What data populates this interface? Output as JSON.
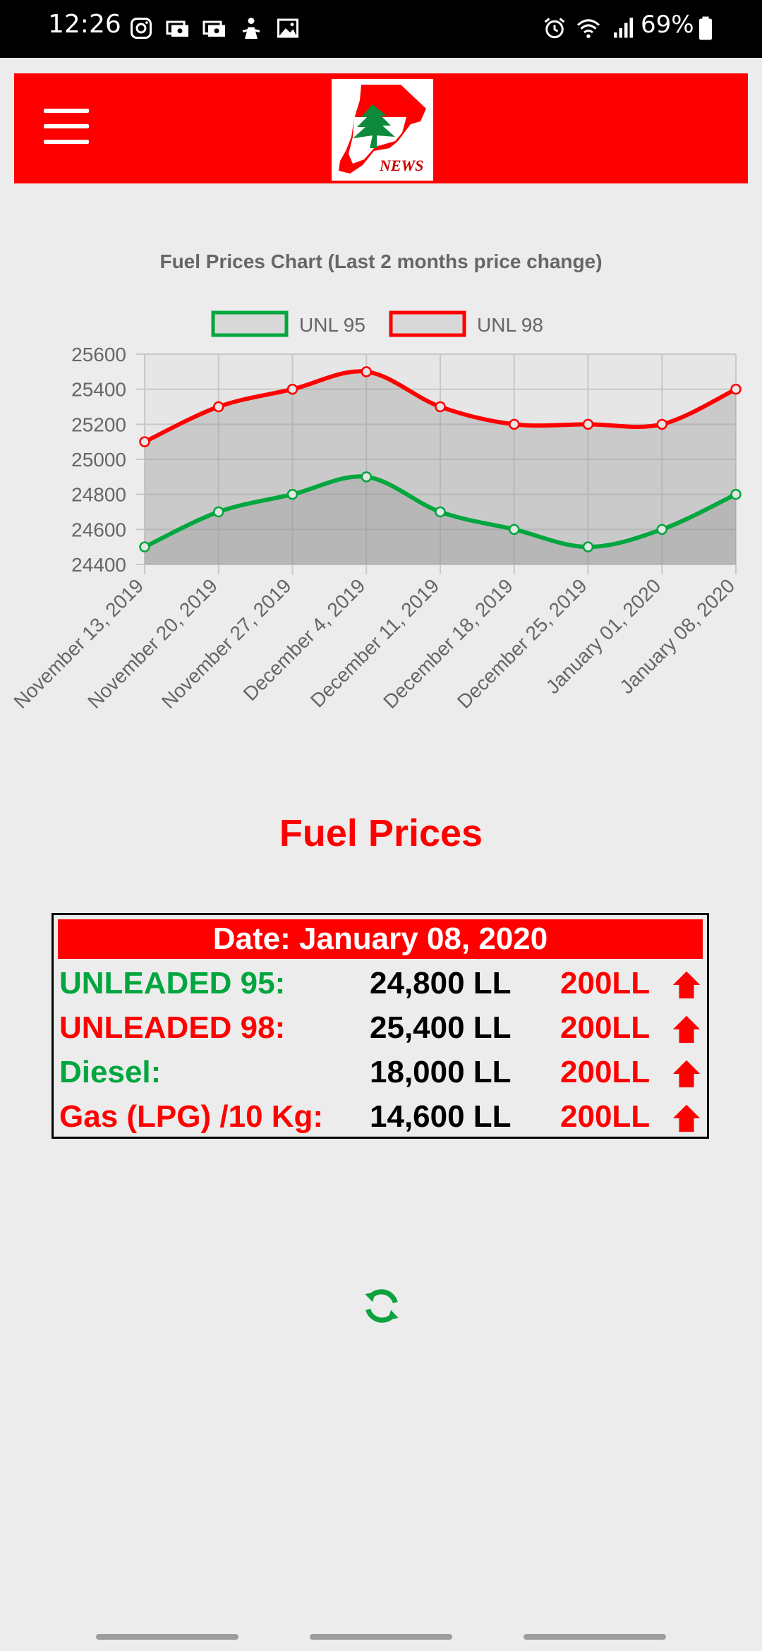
{
  "status_bar": {
    "time": "12:26",
    "battery_percent": "69%",
    "left_icons": [
      "instagram-icon",
      "money-icon",
      "money-icon",
      "person-icon",
      "image-icon"
    ],
    "right_icons": [
      "alarm-icon",
      "wifi-icon",
      "signal-icon",
      "battery-icon"
    ]
  },
  "header": {
    "logo_text": "NEWS",
    "background": "#ff0000",
    "menu_icon": "hamburger-icon"
  },
  "chart_data": {
    "type": "line",
    "title": "Fuel Prices Chart (Last 2 months price change)",
    "categories": [
      "November 13, 2019",
      "November 20, 2019",
      "November 27, 2019",
      "December 4, 2019",
      "December 11, 2019",
      "December 18, 2019",
      "December 25, 2019",
      "January 01, 2020",
      "January 08, 2020"
    ],
    "series": [
      {
        "name": "UNL 95",
        "color": "#00a63e",
        "values": [
          24500,
          24700,
          24800,
          24900,
          24700,
          24600,
          24500,
          24600,
          24800
        ]
      },
      {
        "name": "UNL 98",
        "color": "#ff0000",
        "values": [
          25100,
          25300,
          25400,
          25500,
          25300,
          25200,
          25200,
          25200,
          25400
        ]
      }
    ],
    "y_ticks": [
      25600,
      25400,
      25200,
      25000,
      24800,
      24600,
      24400
    ],
    "ylim": [
      24400,
      25600
    ],
    "grid": true,
    "fill": true,
    "legend_position": "top"
  },
  "prices": {
    "title": "Fuel Prices",
    "date_label": "Date: January 08, 2020",
    "rows": [
      {
        "name": "UNLEADED 95:",
        "price": "24,800 LL",
        "change": "200LL",
        "name_color": "#00a63e"
      },
      {
        "name": "UNLEADED 98:",
        "price": "25,400 LL",
        "change": "200LL",
        "name_color": "#ff0000"
      },
      {
        "name": "Diesel:",
        "price": "18,000 LL",
        "change": "200LL",
        "name_color": "#00a63e"
      },
      {
        "name": "Gas (LPG) /10 Kg:",
        "price": "14,600 LL",
        "change": "200LL",
        "name_color": "#ff0000"
      }
    ],
    "change_direction_icon": "arrow-up-icon"
  },
  "refresh_icon": "refresh-icon"
}
